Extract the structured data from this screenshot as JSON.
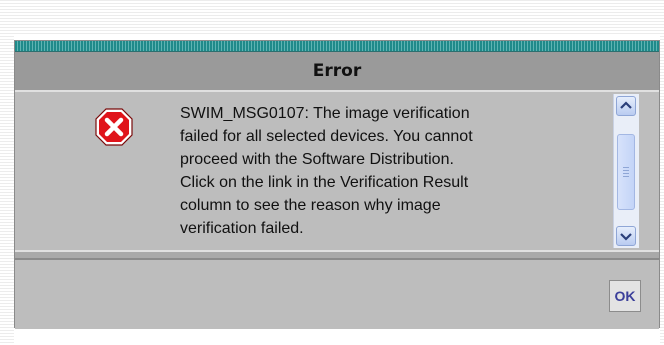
{
  "dialog": {
    "title": "Error",
    "message": "SWIM_MSG0107: The image verification\nfailed for all selected devices. You cannot\nproceed with the Software Distribution.\nClick on the link in the Verification Result\ncolumn to see the reason why image\nverification failed.",
    "icon": "error-x-icon",
    "ok_label": "OK"
  },
  "colors": {
    "title_accent": "#1f8a8a",
    "dialog_bg": "#bdbdbd",
    "title_bar_bg": "#9a9a9a",
    "error_icon_red": "#e0141b",
    "ok_text": "#3b3f9a"
  }
}
